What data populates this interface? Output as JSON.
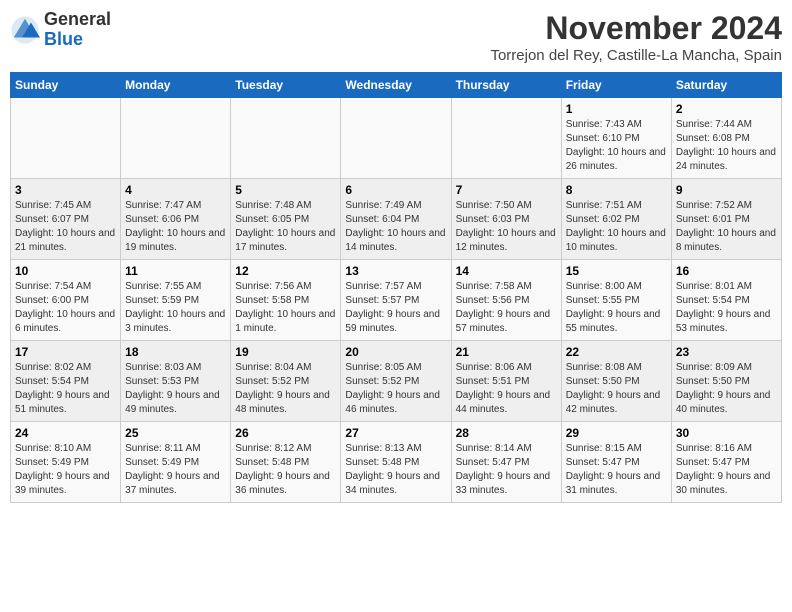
{
  "logo": {
    "general": "General",
    "blue": "Blue"
  },
  "title": "November 2024",
  "location": "Torrejon del Rey, Castille-La Mancha, Spain",
  "days_of_week": [
    "Sunday",
    "Monday",
    "Tuesday",
    "Wednesday",
    "Thursday",
    "Friday",
    "Saturday"
  ],
  "weeks": [
    [
      {
        "day": "",
        "info": ""
      },
      {
        "day": "",
        "info": ""
      },
      {
        "day": "",
        "info": ""
      },
      {
        "day": "",
        "info": ""
      },
      {
        "day": "",
        "info": ""
      },
      {
        "day": "1",
        "info": "Sunrise: 7:43 AM\nSunset: 6:10 PM\nDaylight: 10 hours and 26 minutes."
      },
      {
        "day": "2",
        "info": "Sunrise: 7:44 AM\nSunset: 6:08 PM\nDaylight: 10 hours and 24 minutes."
      }
    ],
    [
      {
        "day": "3",
        "info": "Sunrise: 7:45 AM\nSunset: 6:07 PM\nDaylight: 10 hours and 21 minutes."
      },
      {
        "day": "4",
        "info": "Sunrise: 7:47 AM\nSunset: 6:06 PM\nDaylight: 10 hours and 19 minutes."
      },
      {
        "day": "5",
        "info": "Sunrise: 7:48 AM\nSunset: 6:05 PM\nDaylight: 10 hours and 17 minutes."
      },
      {
        "day": "6",
        "info": "Sunrise: 7:49 AM\nSunset: 6:04 PM\nDaylight: 10 hours and 14 minutes."
      },
      {
        "day": "7",
        "info": "Sunrise: 7:50 AM\nSunset: 6:03 PM\nDaylight: 10 hours and 12 minutes."
      },
      {
        "day": "8",
        "info": "Sunrise: 7:51 AM\nSunset: 6:02 PM\nDaylight: 10 hours and 10 minutes."
      },
      {
        "day": "9",
        "info": "Sunrise: 7:52 AM\nSunset: 6:01 PM\nDaylight: 10 hours and 8 minutes."
      }
    ],
    [
      {
        "day": "10",
        "info": "Sunrise: 7:54 AM\nSunset: 6:00 PM\nDaylight: 10 hours and 6 minutes."
      },
      {
        "day": "11",
        "info": "Sunrise: 7:55 AM\nSunset: 5:59 PM\nDaylight: 10 hours and 3 minutes."
      },
      {
        "day": "12",
        "info": "Sunrise: 7:56 AM\nSunset: 5:58 PM\nDaylight: 10 hours and 1 minute."
      },
      {
        "day": "13",
        "info": "Sunrise: 7:57 AM\nSunset: 5:57 PM\nDaylight: 9 hours and 59 minutes."
      },
      {
        "day": "14",
        "info": "Sunrise: 7:58 AM\nSunset: 5:56 PM\nDaylight: 9 hours and 57 minutes."
      },
      {
        "day": "15",
        "info": "Sunrise: 8:00 AM\nSunset: 5:55 PM\nDaylight: 9 hours and 55 minutes."
      },
      {
        "day": "16",
        "info": "Sunrise: 8:01 AM\nSunset: 5:54 PM\nDaylight: 9 hours and 53 minutes."
      }
    ],
    [
      {
        "day": "17",
        "info": "Sunrise: 8:02 AM\nSunset: 5:54 PM\nDaylight: 9 hours and 51 minutes."
      },
      {
        "day": "18",
        "info": "Sunrise: 8:03 AM\nSunset: 5:53 PM\nDaylight: 9 hours and 49 minutes."
      },
      {
        "day": "19",
        "info": "Sunrise: 8:04 AM\nSunset: 5:52 PM\nDaylight: 9 hours and 48 minutes."
      },
      {
        "day": "20",
        "info": "Sunrise: 8:05 AM\nSunset: 5:52 PM\nDaylight: 9 hours and 46 minutes."
      },
      {
        "day": "21",
        "info": "Sunrise: 8:06 AM\nSunset: 5:51 PM\nDaylight: 9 hours and 44 minutes."
      },
      {
        "day": "22",
        "info": "Sunrise: 8:08 AM\nSunset: 5:50 PM\nDaylight: 9 hours and 42 minutes."
      },
      {
        "day": "23",
        "info": "Sunrise: 8:09 AM\nSunset: 5:50 PM\nDaylight: 9 hours and 40 minutes."
      }
    ],
    [
      {
        "day": "24",
        "info": "Sunrise: 8:10 AM\nSunset: 5:49 PM\nDaylight: 9 hours and 39 minutes."
      },
      {
        "day": "25",
        "info": "Sunrise: 8:11 AM\nSunset: 5:49 PM\nDaylight: 9 hours and 37 minutes."
      },
      {
        "day": "26",
        "info": "Sunrise: 8:12 AM\nSunset: 5:48 PM\nDaylight: 9 hours and 36 minutes."
      },
      {
        "day": "27",
        "info": "Sunrise: 8:13 AM\nSunset: 5:48 PM\nDaylight: 9 hours and 34 minutes."
      },
      {
        "day": "28",
        "info": "Sunrise: 8:14 AM\nSunset: 5:47 PM\nDaylight: 9 hours and 33 minutes."
      },
      {
        "day": "29",
        "info": "Sunrise: 8:15 AM\nSunset: 5:47 PM\nDaylight: 9 hours and 31 minutes."
      },
      {
        "day": "30",
        "info": "Sunrise: 8:16 AM\nSunset: 5:47 PM\nDaylight: 9 hours and 30 minutes."
      }
    ]
  ]
}
